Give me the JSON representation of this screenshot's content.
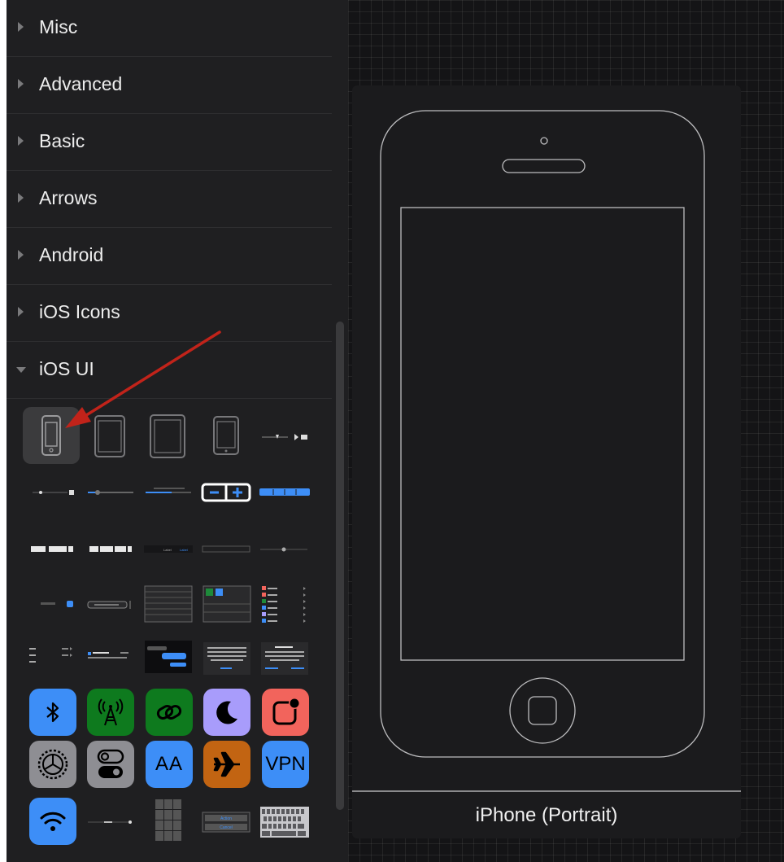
{
  "sidebar": {
    "sections": [
      {
        "label": "Misc",
        "expanded": false
      },
      {
        "label": "Advanced",
        "expanded": false
      },
      {
        "label": "Basic",
        "expanded": false
      },
      {
        "label": "Arrows",
        "expanded": false
      },
      {
        "label": "Android",
        "expanded": false
      },
      {
        "label": "iOS Icons",
        "expanded": false
      },
      {
        "label": "iOS UI",
        "expanded": true
      }
    ],
    "ios_ui_icons": {
      "row1": [
        "bluetooth-icon",
        "cellular-antenna-icon",
        "link-icon",
        "moon-icon",
        "notification-icon"
      ],
      "row2": [
        "settings-gear-icon",
        "toggle-switches-icon",
        "text-size-icon",
        "airplane-icon",
        "vpn-icon"
      ],
      "vpn_label": "VPN",
      "text_size_label": "AA"
    },
    "icon_colors": {
      "bluetooth": "#3d8ef7",
      "cellular": "#0e7a1e",
      "link": "#0e7a1e",
      "moon": "#a89cfb",
      "notification": "#f2645c",
      "settings": "#8e8e93",
      "toggles": "#8e8e93",
      "text_size": "#3d8ef7",
      "airplane": "#c26412",
      "vpn": "#3d8ef7",
      "wifi": "#3d8ef7"
    },
    "mini_labels": {
      "action": "Action",
      "cancel": "Cancel",
      "label": "Label"
    }
  },
  "canvas": {
    "shape_caption": "iPhone (Portrait)"
  }
}
